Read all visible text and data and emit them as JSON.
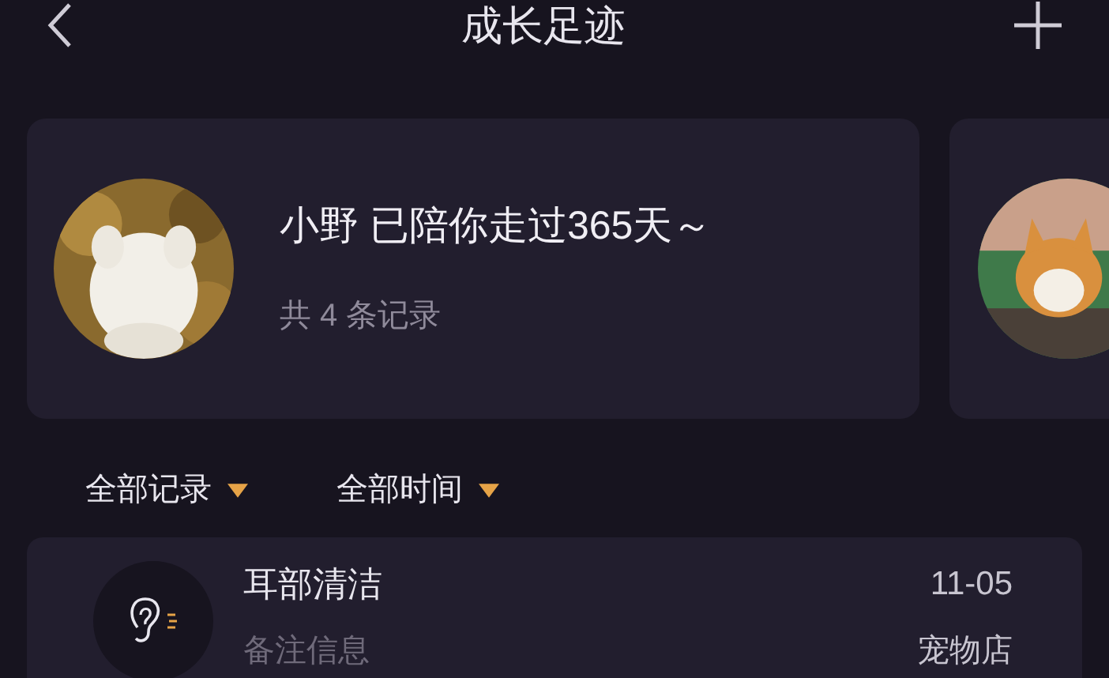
{
  "header": {
    "title": "成长足迹"
  },
  "profile": {
    "headline": "小野 已陪你走过365天～",
    "record_count": "共 4 条记录"
  },
  "filters": [
    {
      "label": "全部记录"
    },
    {
      "label": "全部时间"
    }
  ],
  "records": [
    {
      "title": "耳部清洁",
      "date": "11-05",
      "note": "备注信息",
      "place": "宠物店"
    }
  ]
}
